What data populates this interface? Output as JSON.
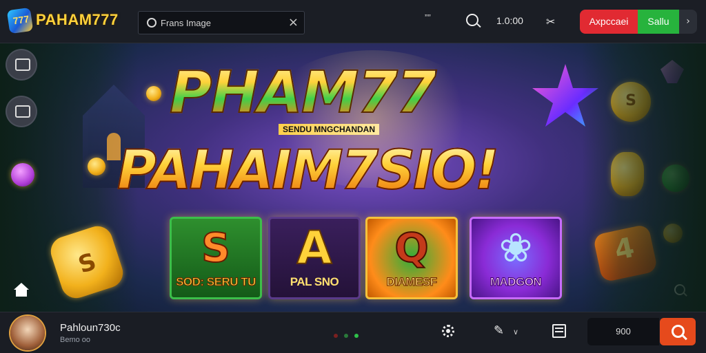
{
  "header": {
    "logo_mark_text": "777",
    "logo_text": "PAHAM777",
    "search_placeholder": "Frans Image",
    "quote_text": "””",
    "balance": "1.0:00",
    "ticket_glyph": "✂",
    "login_label": "Ахрссаеі",
    "signup_label": "Sallu",
    "more_glyph": "›"
  },
  "hero": {
    "title_primary": "PHAM77",
    "subtitle": "SENDU MNGCHANDAN",
    "title_secondary": "PAHAIM7SIO!",
    "coin_symbol": "S",
    "shield_text": "4",
    "cards": [
      {
        "big": "S",
        "label": "SOD: SERU TU"
      },
      {
        "big": "A",
        "label": "PAL SNO"
      },
      {
        "big": "Q",
        "label": "DIAMESF"
      },
      {
        "big": "❀",
        "label": "MADGON"
      }
    ]
  },
  "footer": {
    "username": "Pahloun730c",
    "user_sub": "Bemo oo",
    "pen_glyph": "✎",
    "pen_chevron": "∨",
    "amount": "900"
  },
  "colors": {
    "accent_red": "#e12a32",
    "accent_green": "#27b33d",
    "accent_orange": "#e64a1c",
    "gold": "#ffd23a"
  }
}
